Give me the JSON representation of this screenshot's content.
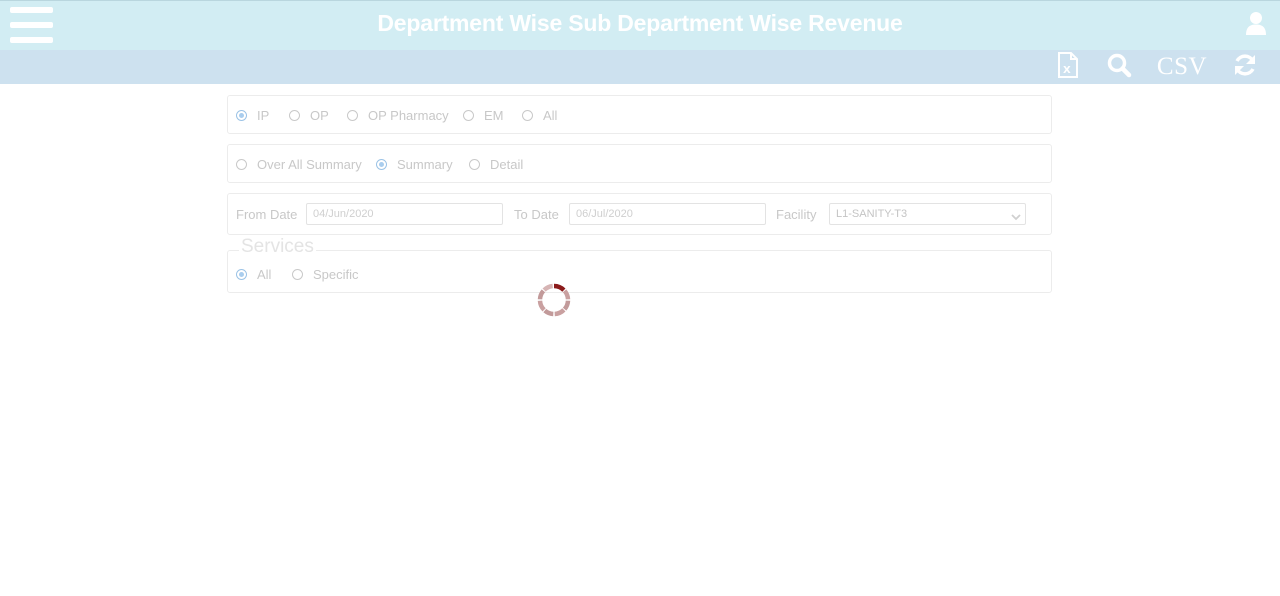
{
  "header": {
    "title": "Department Wise Sub Department Wise Revenue"
  },
  "toolbar": {
    "excel_icon": "excel-file-icon",
    "search_icon": "search-icon",
    "csv_label": "CSV",
    "refresh_icon": "refresh-icon"
  },
  "visit_type": {
    "options": [
      "IP",
      "OP",
      "OP Pharmacy",
      "EM",
      "All"
    ],
    "selected": "IP"
  },
  "report_type": {
    "options": [
      "Over All Summary",
      "Summary",
      "Detail"
    ],
    "selected": "Summary"
  },
  "filters": {
    "from_date_label": "From Date",
    "from_date_value": "04/Jun/2020",
    "to_date_label": "To Date",
    "to_date_value": "06/Jul/2020",
    "facility_label": "Facility",
    "facility_value": "L1-SANITY-T3"
  },
  "services": {
    "legend": "Services",
    "options": [
      "All",
      "Specific"
    ],
    "selected": "All"
  },
  "colors": {
    "header_bg": "#d2edf3",
    "toolbar_bg": "#cde1ef",
    "spinner_accent": "#8b1a1a"
  }
}
